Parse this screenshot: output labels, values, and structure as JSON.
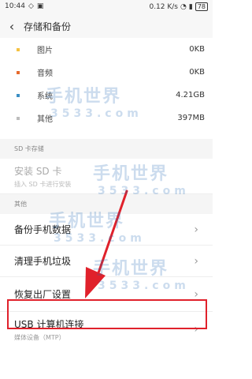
{
  "status_bar": {
    "time": "10:44",
    "network_speed": "0.12 K/s",
    "battery": "78"
  },
  "header": {
    "back_icon": "back-arrow-icon",
    "title": "存储和备份"
  },
  "storage": {
    "items": [
      {
        "label": "图片",
        "size": "0KB",
        "color": "#f5c242"
      },
      {
        "label": "音频",
        "size": "0KB",
        "color": "#e66a2c"
      },
      {
        "label": "系统",
        "size": "4.21GB",
        "color": "#3b8fc4"
      },
      {
        "label": "其他",
        "size": "397MB",
        "color": "#bdbdbd"
      }
    ]
  },
  "sd_section": {
    "header": "SD 卡存储",
    "install_title": "安装 SD 卡",
    "install_sub": "插入 SD 卡进行安装"
  },
  "other_section": {
    "header": "其他",
    "items": [
      {
        "title": "备份手机数据"
      },
      {
        "title": "清理手机垃圾"
      },
      {
        "title": "恢复出厂设置"
      },
      {
        "title": "USB 计算机连接",
        "subtitle": "媒体设备（MTP）"
      }
    ]
  },
  "watermark": {
    "name": "手机世界",
    "code": "3533.com"
  },
  "colors": {
    "highlight": "#e0212b",
    "watermark": "#1a66b3"
  }
}
